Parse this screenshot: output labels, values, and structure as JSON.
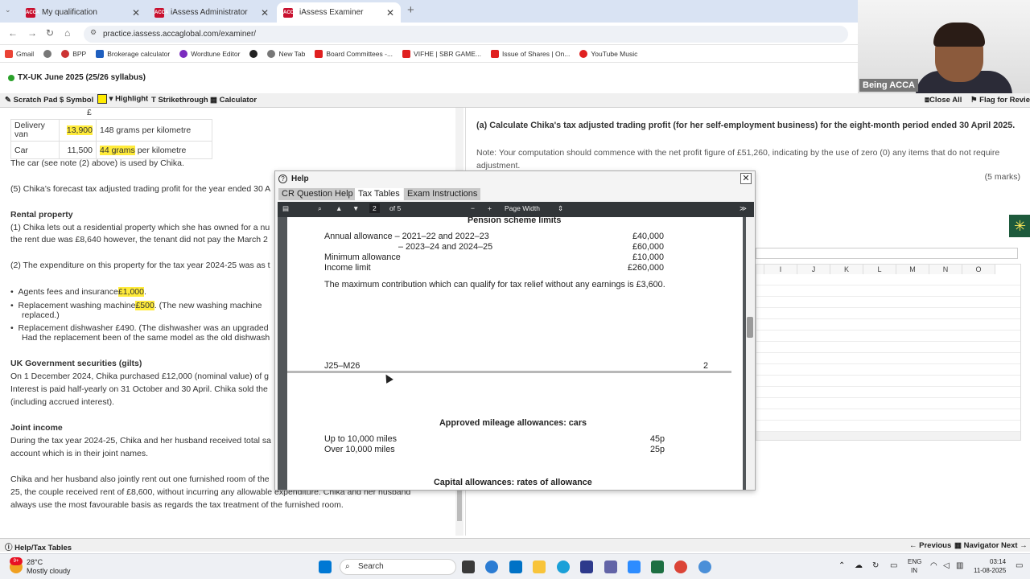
{
  "browser": {
    "tabs": [
      {
        "title": "My qualification",
        "favicon": "ACCA"
      },
      {
        "title": "iAssess Administrator",
        "favicon": "ACCA"
      },
      {
        "title": "iAssess Examiner",
        "favicon": "ACCA"
      }
    ],
    "new_tab": "+",
    "url": "practice.iassess.accaglobal.com/examiner/",
    "bookmarks": [
      "Gmail",
      "BPP",
      "Brokerage calculator",
      "Wordtune Editor",
      "",
      "New Tab",
      "Board Committees -...",
      "VIFHE | SBR GAME...",
      "Issue of Shares | On...",
      "YouTube Music"
    ]
  },
  "webcam": {
    "label": "Being ACCA"
  },
  "exam": {
    "title": "TX-UK June 2025 (25/26 syllabus)",
    "tools": {
      "scratch": "Scratch Pad",
      "symbol": "Symbol",
      "highlight": "Highlight",
      "strike": "Strikethrough",
      "calc": "Calculator",
      "close_all": "Close All",
      "flag": "Flag for Review"
    }
  },
  "left": {
    "pound": "£",
    "cars": [
      {
        "name": "Delivery van",
        "price": "13,900",
        "emission_hl": "",
        "emission": "148 grams per kilometre"
      },
      {
        "name": "Car",
        "price": "11,500",
        "emission_hl": "44 grams",
        "emission": "per kilometre"
      }
    ],
    "car_note": "The car (see note (2) above) is used by Chika.",
    "note5": "(5) Chika’s forecast tax adjusted trading profit for the year ended 30 A",
    "rental_h": "Rental property",
    "rental1a": "(1) Chika lets out a residential property which she has owned for a nu",
    "rental1b": "the rent due was £8,640 however, the tenant did not pay the March 2",
    "rental2": "(2) The expenditure on this property for the tax year 2024-25 was as t",
    "b1": "Agents fees and insurance",
    "b1v": "£1,000",
    "b1e": ".",
    "b2": "Replacement washing machine",
    "b2v": "£500",
    "b2e": ". (The new washing machine",
    "b2f": "replaced.)",
    "b3": "Replacement dishwasher £490. (The dishwasher was an upgraded",
    "b3b": "Had the replacement been of the same model as the old dishwash",
    "gilts_h": "UK Government securities (gilts)",
    "gilts1": "On 1 December 2024, Chika purchased £12,000 (nominal value) of g",
    "gilts2": "Interest is paid half-yearly on 31 October and 30 April. Chika sold the",
    "gilts3": "(including accrued interest).",
    "joint_h": "Joint income",
    "joint1": "During the tax year 2024-25, Chika and her husband received total sa",
    "joint2": "account which is in their joint names.",
    "joint3": "Chika and her husband also jointly rent out one furnished room of the",
    "joint4": "25, the couple received rent of £8,600, without incurring any allowable expenditure. Chika and her husband",
    "joint5": "always use the most favourable basis as regards the tax treatment of the furnished room."
  },
  "right": {
    "question": "(a) Calculate Chika's tax adjusted trading profit (for her self-employment business) for the eight-month period ended 30 April 2025.",
    "note": "Note: Your computation should commence with the net profit figure of £51,260, indicating by the use of zero (0) any items that do not require adjustment.",
    "marks": "(5 marks)",
    "columns": [
      "I",
      "J",
      "K",
      "L",
      "M",
      "N",
      "O"
    ]
  },
  "help": {
    "title": "Help",
    "tabs": [
      "CR Question Help",
      "Tax Tables",
      "Exam Instructions"
    ],
    "pdf": {
      "page": "2",
      "of": "of 5",
      "zoom": "Page Width"
    },
    "pension_h": "Pension scheme limits",
    "aa_label": "Annual allowance – 2021–22 and 2022–23",
    "aa_val": "£40,000",
    "aa2_label": "– 2023–24 and 2024–25",
    "aa2_val": "£60,000",
    "min_label": "Minimum allowance",
    "min_val": "£10,000",
    "inc_label": "Income limit",
    "inc_val": "£260,000",
    "max_text": "The maximum contribution which can qualify for tax relief without any earnings is £3,600.",
    "footer_code": "J25–M26",
    "footer_page": "2",
    "mileage_h": "Approved mileage allowances: cars",
    "up_label": "Up to 10,000 miles",
    "up_val": "45p",
    "over_label": "Over 10,000 miles",
    "over_val": "25p",
    "capital_h": "Capital allowances: rates of allowance"
  },
  "bottom": {
    "help_tables": "Help/Tax Tables",
    "previous": "Previous",
    "navigator": "Navigator",
    "next": "Next"
  },
  "taskbar": {
    "weather_temp": "28°C",
    "weather_desc": "Mostly cloudy",
    "search": "Search",
    "lang1": "ENG",
    "lang2": "IN",
    "time": "03:14",
    "date": "11-08-2025",
    "badge": "9+"
  }
}
